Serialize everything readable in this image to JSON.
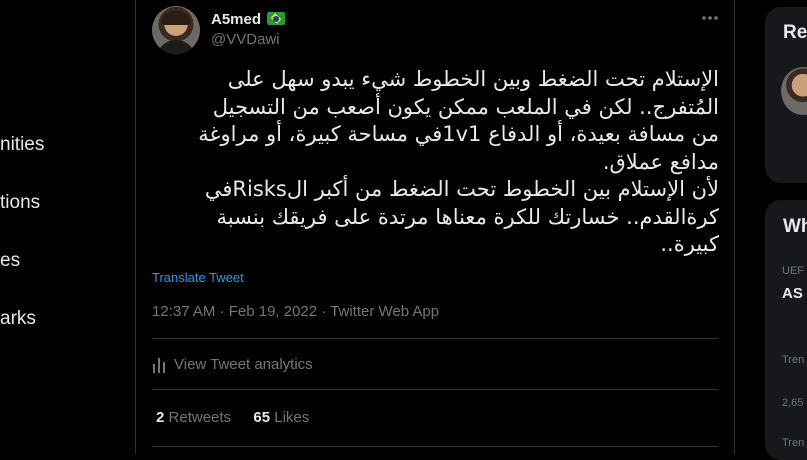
{
  "sidebar": {
    "items": [
      {
        "label": "nities"
      },
      {
        "label": "tions"
      },
      {
        "label": "es"
      },
      {
        "label": "arks"
      }
    ]
  },
  "tweet": {
    "author": {
      "display_name": "A5med",
      "handle": "@VVDawi"
    },
    "text_lines": [
      "الإستلام تحت الضغط وبين الخطوط شيء يبدو سهل على",
      "المُتفرج.. لكن في الملعب ممكن يكون أصعب من التسجيل",
      "من مسافة بعيدة، أو الدفاع 1v1في مساحة كبيرة، أو مراوغة",
      "مدافع عملاق.",
      "لأن الإستلام بين الخطوط تحت الضغط من أكبر الRisksفي",
      "كرةالقدم.. خسارتك للكرة معناها مرتدة على فريقك بنسبة",
      "كبيرة.."
    ],
    "translate_label": "Translate Tweet",
    "timestamp": "12:37 AM · Feb 19, 2022 · Twitter Web App",
    "analytics_label": "View Tweet analytics",
    "retweets_count": "2",
    "retweets_label": "Retweets",
    "likes_count": "65",
    "likes_label": "Likes"
  },
  "right_panel": {
    "relevant_title": "Re",
    "trends_title": "Wh",
    "trend_category": "UEF",
    "trend_name": "AS",
    "trend_label": "Tren",
    "trend_count": "2,65",
    "trend_label_2": "Tren"
  }
}
